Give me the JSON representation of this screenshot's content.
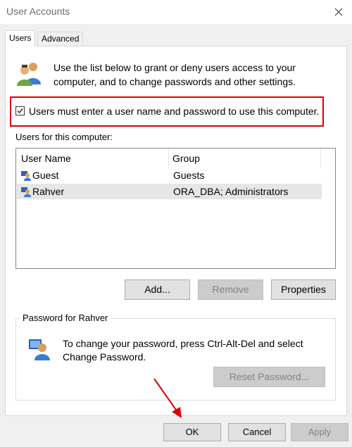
{
  "window": {
    "title": "User Accounts"
  },
  "tabs": [
    {
      "label": "Users"
    },
    {
      "label": "Advanced"
    }
  ],
  "intro": {
    "text": "Use the list below to grant or deny users access to your computer, and to change passwords and other settings."
  },
  "require_login": {
    "label": "Users must enter a user name and password to use this computer.",
    "checked": true
  },
  "users_section": {
    "label": "Users for this computer:"
  },
  "list": {
    "columns": [
      "User Name",
      "Group"
    ],
    "rows": [
      {
        "name": "Guest",
        "group": "Guests",
        "selected": false
      },
      {
        "name": "Rahver",
        "group": "ORA_DBA; Administrators",
        "selected": true
      }
    ]
  },
  "buttons": {
    "add": "Add...",
    "remove": "Remove",
    "properties": "Properties",
    "reset_password": "Reset Password...",
    "ok": "OK",
    "cancel": "Cancel",
    "apply": "Apply"
  },
  "password_group": {
    "label": "Password for Rahver",
    "text": "To change your password, press Ctrl-Alt-Del and select Change Password."
  },
  "colors": {
    "highlight_box": "#e00000",
    "annotation_arrow": "#e00000"
  }
}
